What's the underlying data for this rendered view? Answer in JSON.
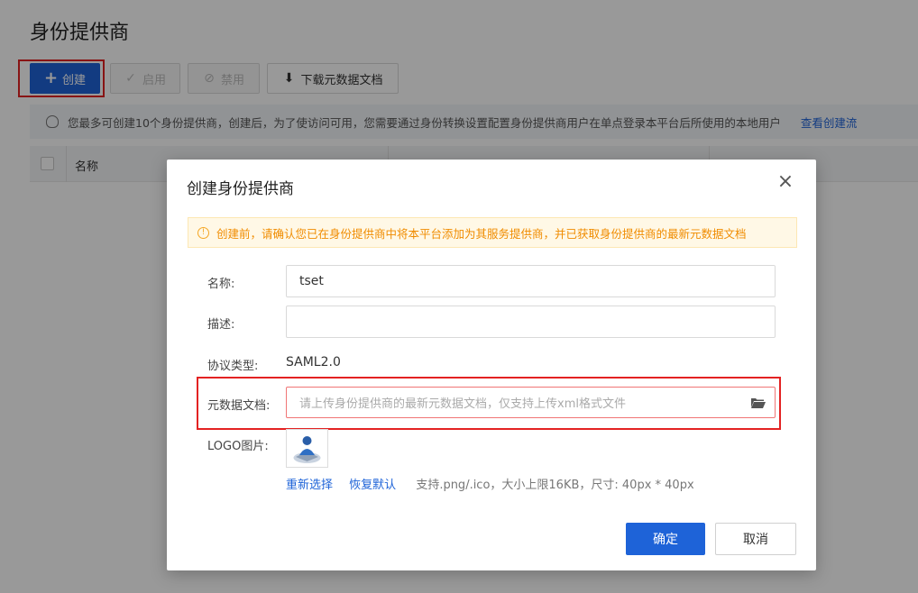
{
  "page": {
    "title": "身份提供商"
  },
  "toolbar": {
    "create_label": "创建",
    "enable_label": "启用",
    "disable_label": "禁用",
    "download_label": "下载元数据文档"
  },
  "info_bar": {
    "text": "您最多可创建10个身份提供商，创建后，为了使访问可用，您需要通过身份转换设置配置身份提供商用户在单点登录本平台后所使用的本地用户",
    "link": "查看创建流"
  },
  "table": {
    "columns": [
      "名称"
    ]
  },
  "dialog": {
    "title": "创建身份提供商",
    "warning": "创建前，请确认您已在身份提供商中将本平台添加为其服务提供商，并已获取身份提供商的最新元数据文档",
    "fields": {
      "name_label": "名称:",
      "name_value": "tset",
      "desc_label": "描述:",
      "desc_value": "",
      "protocol_label": "协议类型:",
      "protocol_value": "SAML2.0",
      "metadata_label": "元数据文档:",
      "metadata_placeholder": "请上传身份提供商的最新元数据文档，仅支持上传xml格式文件",
      "logo_label": "LOGO图片:"
    },
    "logo": {
      "reselect": "重新选择",
      "restore": "恢复默认",
      "hint": "支持.png/.ico，大小上限16KB，尺寸: 40px * 40px"
    },
    "ok_label": "确定",
    "cancel_label": "取消"
  },
  "colors": {
    "primary": "#1e63d8",
    "highlight_outline": "#e32222",
    "warning_text": "#f08c00",
    "warning_bg": "#fff8e6"
  },
  "icons": [
    "plus-icon",
    "check-icon",
    "ban-icon",
    "download-icon",
    "lightbulb-icon",
    "close-icon",
    "info-icon",
    "folder-icon",
    "logo-user-icon"
  ]
}
